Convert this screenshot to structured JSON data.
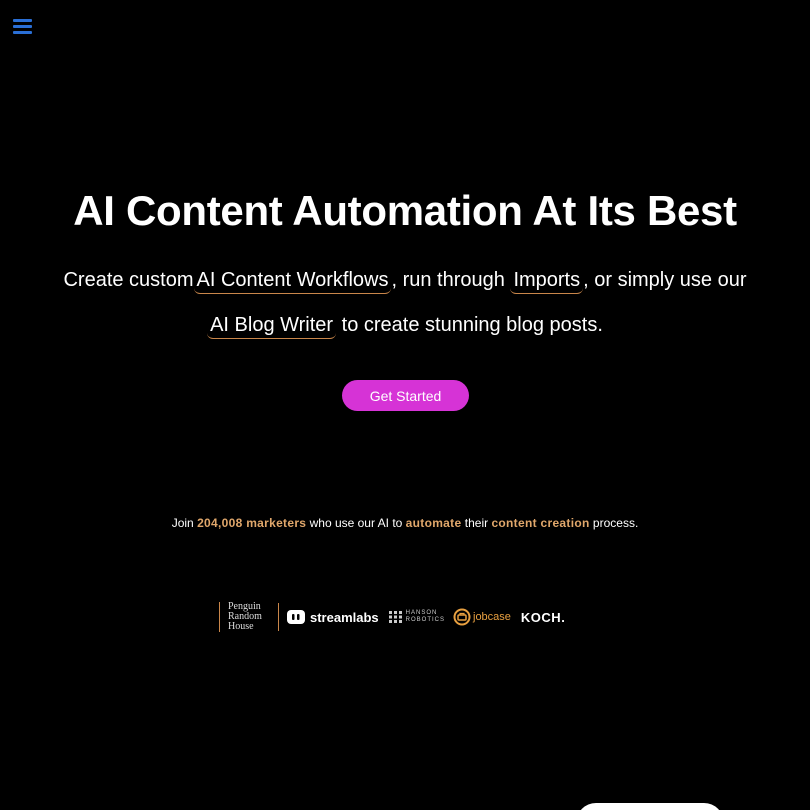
{
  "nav": {
    "menu_icon": "hamburger-menu-icon",
    "menu_color": "#2a6fd6"
  },
  "hero": {
    "title": "AI Content Automation At Its Best",
    "sub_1": "Create custom",
    "link_workflows": "AI Content Workflows",
    "sub_2": ", run through ",
    "link_imports": "Imports",
    "sub_3": ", or simply use our ",
    "link_blog_writer": "AI Blog Writer",
    "sub_4": " to create stunning blog posts.",
    "cta_label": "Get Started",
    "cta_color": "#d633d6",
    "link_underline_color": "#c9864a"
  },
  "social_proof": {
    "join": "Join ",
    "count": "204,008 marketers",
    "who": " who use our AI to ",
    "automate": "automate",
    "their": " their ",
    "content_creation": "content creation",
    "process": " process.",
    "highlight_color": "#e0a76b"
  },
  "logos": {
    "penguin": [
      "Penguin",
      "Random",
      "House"
    ],
    "streamlabs": "streamlabs",
    "hanson": [
      "HANSON",
      "ROBOTICS"
    ],
    "jobcase": "jobcase",
    "koch": "KOCH."
  }
}
